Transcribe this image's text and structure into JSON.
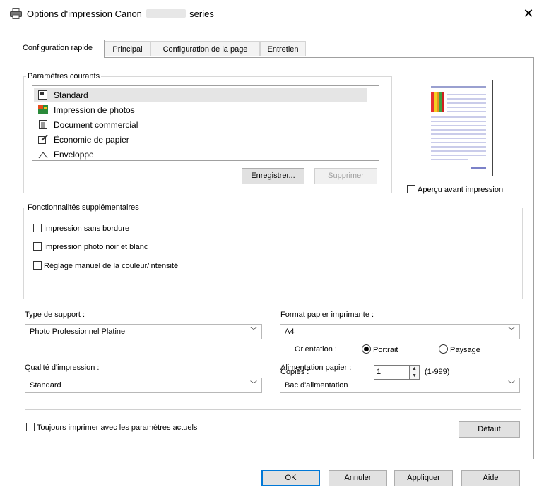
{
  "window": {
    "title_prefix": "Options d'impression Canon",
    "title_suffix": "series",
    "close_glyph": "✕",
    "printer_icon": "printer-icon"
  },
  "tabs": [
    {
      "label": "Configuration rapide",
      "active": true
    },
    {
      "label": "Principal"
    },
    {
      "label": "Configuration de la page"
    },
    {
      "label": "Entretien"
    }
  ],
  "current_settings": {
    "legend": "Paramètres courants",
    "items": [
      {
        "label": "Standard",
        "icon": "standard-icon",
        "selected": true
      },
      {
        "label": "Impression de photos",
        "icon": "photo-icon"
      },
      {
        "label": "Document commercial",
        "icon": "document-icon"
      },
      {
        "label": "Économie de papier",
        "icon": "paper-saving-icon"
      },
      {
        "label": "Enveloppe",
        "icon": "envelope-icon"
      }
    ],
    "save_button": "Enregistrer...",
    "delete_button": "Supprimer"
  },
  "preview": {
    "checkbox_label": "Aperçu avant impression",
    "checked": false
  },
  "additional_features": {
    "legend": "Fonctionnalités supplémentaires",
    "options": [
      {
        "label": "Impression sans bordure",
        "checked": false
      },
      {
        "label": "Impression photo noir et blanc",
        "checked": false
      },
      {
        "label": "Réglage manuel de la couleur/intensité",
        "checked": false
      }
    ]
  },
  "media_type": {
    "label": "Type de support :",
    "value": "Photo Professionnel Platine"
  },
  "printer_paper_size": {
    "label": "Format papier imprimante :",
    "value": "A4"
  },
  "orientation": {
    "label": "Orientation :",
    "portrait": "Portrait",
    "landscape": "Paysage",
    "selected": "portrait"
  },
  "print_quality": {
    "label": "Qualité d'impression :",
    "value": "Standard"
  },
  "paper_source": {
    "label": "Alimentation papier :",
    "value": "Bac d'alimentation"
  },
  "copies": {
    "label": "Copies :",
    "value": "1",
    "range": "(1-999)"
  },
  "always_print": {
    "label": "Toujours imprimer avec les paramètres actuels",
    "checked": false
  },
  "buttons": {
    "defaults": "Défaut",
    "ok": "OK",
    "cancel": "Annuler",
    "apply": "Appliquer",
    "help": "Aide"
  },
  "colors": {
    "accent_black": "#000000",
    "border": "#a0a0a0",
    "button_face": "#e1e1e1"
  }
}
